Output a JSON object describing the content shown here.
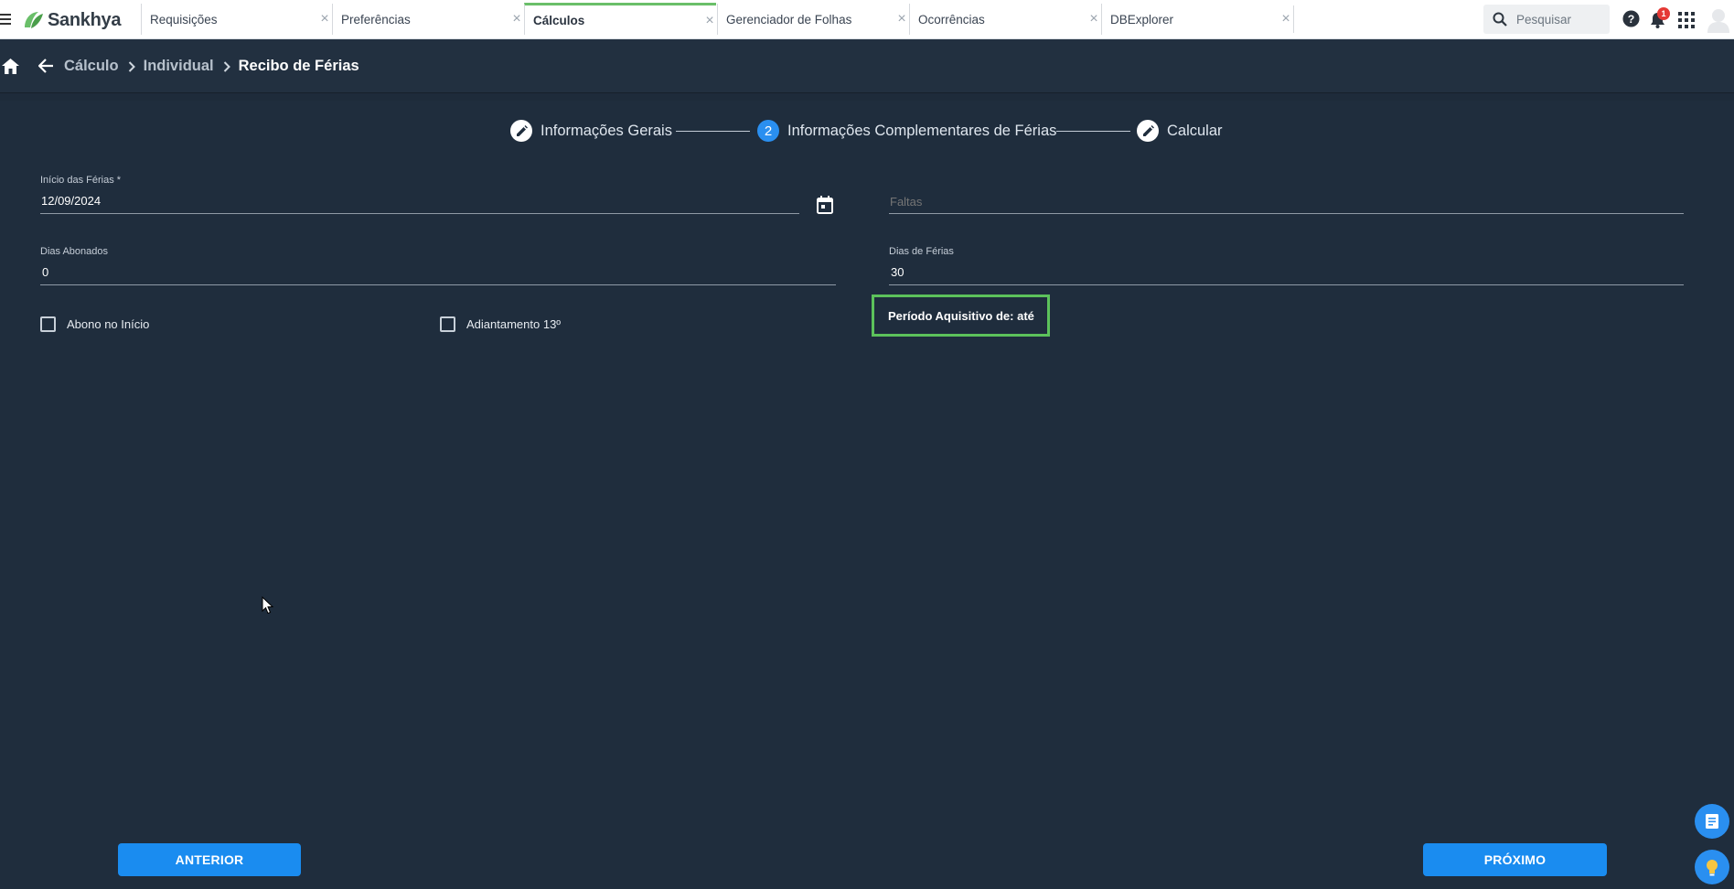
{
  "app": {
    "brand": "Sankhya",
    "accent_color": "#6abf69",
    "primary_color": "#1a8cf0"
  },
  "tabs": [
    {
      "label": "Requisições",
      "active": false
    },
    {
      "label": "Preferências",
      "active": false
    },
    {
      "label": "Cálculos",
      "active": true
    },
    {
      "label": "Gerenciador de Folhas",
      "active": false
    },
    {
      "label": "Ocorrências",
      "active": false
    },
    {
      "label": "DBExplorer",
      "active": false
    }
  ],
  "search": {
    "placeholder": "Pesquisar"
  },
  "notifications": {
    "count": "1"
  },
  "breadcrumb": {
    "items": [
      "Cálculo",
      "Individual"
    ],
    "current": "Recibo de Férias"
  },
  "stepper": {
    "steps": [
      {
        "label": "Informações Gerais",
        "marker": "edit-icon",
        "state": "done"
      },
      {
        "label": "Informações Complementares de Férias",
        "marker": "2",
        "state": "current"
      },
      {
        "label": "Calcular",
        "marker": "edit-icon",
        "state": "done"
      }
    ]
  },
  "form": {
    "inicio_ferias": {
      "label": "Início das Férias *",
      "value": "12/09/2024"
    },
    "faltas": {
      "placeholder": "Faltas",
      "value": ""
    },
    "dias_abonados": {
      "label": "Dias Abonados",
      "value": "0"
    },
    "dias_ferias": {
      "label": "Dias de Férias",
      "value": "30"
    },
    "abono_inicio": {
      "label": "Abono no Início",
      "checked": false
    },
    "adiantamento_13": {
      "label": "Adiantamento 13º",
      "checked": false
    },
    "periodo_aquisitivo": {
      "text": "Período Aquisitivo de: até"
    }
  },
  "buttons": {
    "anterior": "ANTERIOR",
    "proximo": "PRÓXIMO"
  }
}
